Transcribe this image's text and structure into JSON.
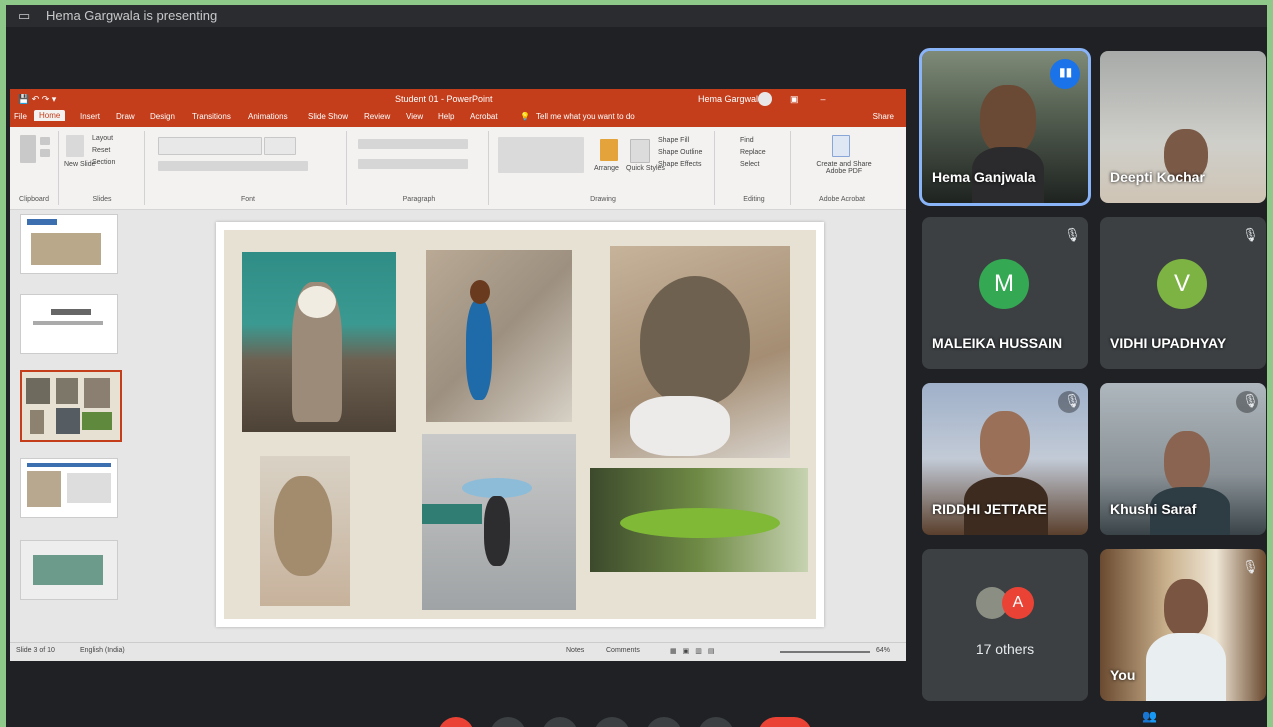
{
  "meet": {
    "presenter_text": "Hema Gargwala is presenting",
    "others_label": "17 others",
    "others_avatar_letter": "A",
    "colors": {
      "accent": "#1a73e8",
      "tile_bg": "#3c4043",
      "end_call": "#ea4335"
    }
  },
  "participants": [
    {
      "name": "Hema Ganjwala",
      "type": "video",
      "speaking": true
    },
    {
      "name": "Deepti Kochar",
      "type": "video"
    },
    {
      "name": "MALEIKA HUSSAIN",
      "type": "avatar",
      "letter": "M",
      "color": "#34a853",
      "muted": true
    },
    {
      "name": "VIDHI UPADHYAY",
      "type": "avatar",
      "letter": "V",
      "color": "#7cb342",
      "muted": true
    },
    {
      "name": "RIDDHI JETTARE",
      "type": "video",
      "muted": true
    },
    {
      "name": "Khushi Saraf",
      "type": "video",
      "muted": true
    },
    {
      "name": "You",
      "type": "video",
      "muted": true
    }
  ],
  "powerpoint": {
    "doc_title": "Student 01 - PowerPoint",
    "user_name": "Hema Gargwala",
    "tabs": [
      "File",
      "Home",
      "Insert",
      "Draw",
      "Design",
      "Transitions",
      "Animations",
      "Slide Show",
      "Review",
      "View",
      "Help",
      "Acrobat"
    ],
    "tell_me": "Tell me what you want to do",
    "share_label": "Share",
    "groups": [
      "Clipboard",
      "Slides",
      "Font",
      "Paragraph",
      "Drawing",
      "Editing",
      "Adobe Acrobat"
    ],
    "tools": {
      "new_slide": "New Slide",
      "layout": "Layout",
      "reset": "Reset",
      "section": "Section",
      "arrange": "Arrange",
      "quick_styles": "Quick Styles",
      "shape_fill": "Shape Fill",
      "shape_outline": "Shape Outline",
      "shape_effects": "Shape Effects",
      "find": "Find",
      "replace": "Replace",
      "select": "Select",
      "create_pdf": "Create and Share Adobe PDF"
    },
    "status": {
      "slide": "Slide 3 of 10",
      "language": "English (India)",
      "notes": "Notes",
      "comments": "Comments",
      "zoom": "64%"
    }
  }
}
